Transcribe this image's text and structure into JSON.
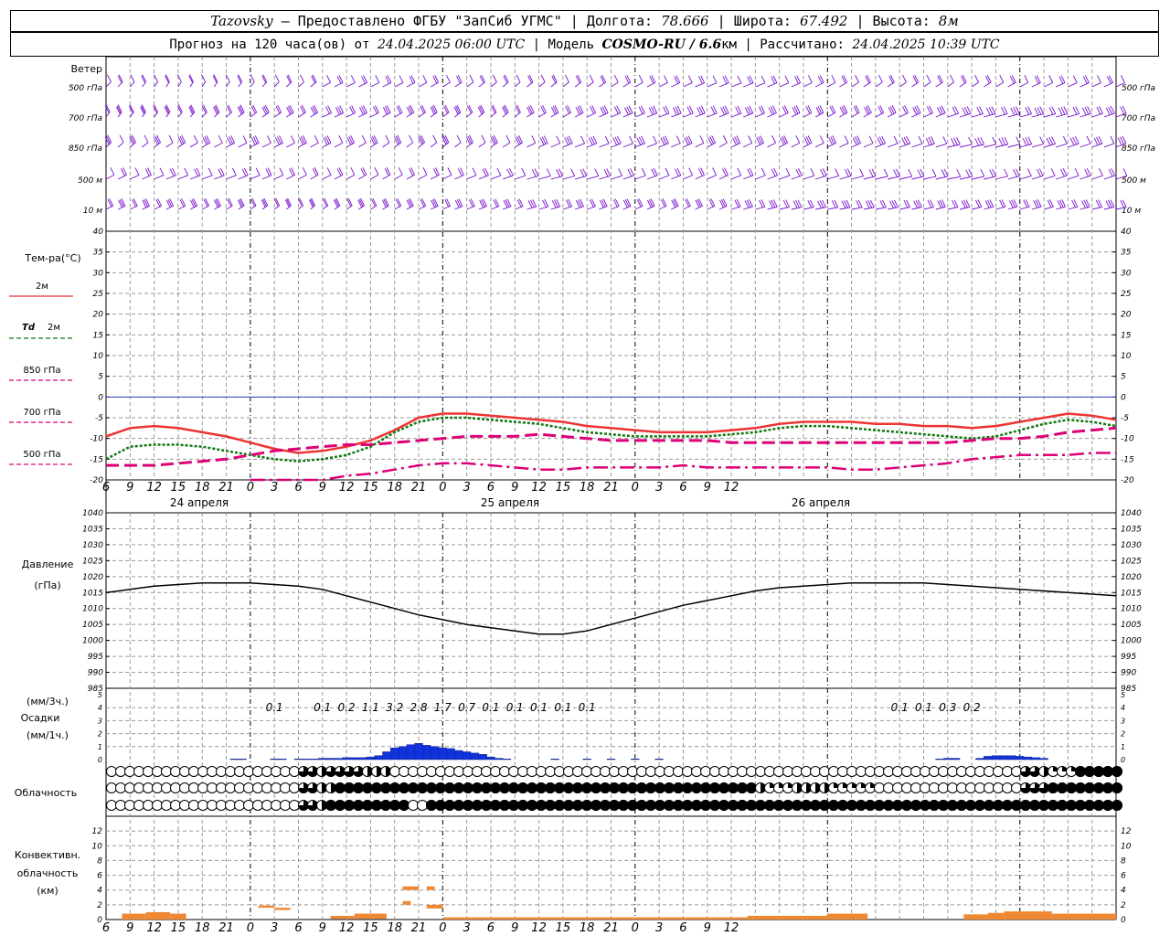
{
  "header": {
    "station": "Tazovsky",
    "provider": "— Предоставлено ФГБУ \"ЗапСиб УГМС\"",
    "lon_label": "Долгота:",
    "lon": "78.666",
    "lat_label": "Широта:",
    "lat": "67.492",
    "alt_label": "Высота:",
    "alt": "8м",
    "forecast_label": "Прогноз на 120 часа(ов) от",
    "forecast_from": "24.04.2025 06:00 UTC",
    "model_label": "Модель",
    "model": "COSMO-RU / 6.6",
    "model_unit": "км",
    "calc_label": "Рассчитано:",
    "calc_time": "24.04.2025 10:39 UTC"
  },
  "labels": {
    "wind": "Ветер",
    "wind_levels": [
      "500 гПа",
      "700 гПа",
      "850 гПа",
      "500 м",
      "10 м"
    ],
    "temp_title": "Тем-ра(°C)",
    "legend_t2m": "2м",
    "legend_td_a": "Td",
    "legend_td_b": "2м",
    "legend_850": "850 гПа",
    "legend_700": "700 гПа",
    "legend_500": "500 гПа",
    "pressure_a": "Давление",
    "pressure_b": "(гПа)",
    "precip_a": "(мм/3ч.)",
    "precip_b": "Осадки",
    "precip_c": "(мм/1ч.)",
    "cloud": "Облачность",
    "conv_a": "Конвективн.",
    "conv_b": "облачность",
    "conv_c": "(км)"
  },
  "colors": {
    "t2m": "#ee3333",
    "td2m": "#117711",
    "t850": "#dd0077",
    "t700": "#dd0077",
    "t500": "#dd0077",
    "wind": "#7711cc",
    "precip": "#1133dd",
    "conv": "#ee8833",
    "zero_line": "#3344cc",
    "grid": "#999999"
  },
  "chart_data": [
    {
      "type": "line",
      "title": "Тем-ра(°C)",
      "x_hours": [
        0,
        3,
        6,
        9,
        12,
        15,
        18,
        21,
        24,
        27,
        30,
        33,
        36,
        39,
        42,
        45,
        48,
        51,
        54,
        57,
        60,
        63,
        66,
        69,
        72,
        75,
        78,
        81,
        84,
        87,
        90,
        93,
        96,
        99,
        102,
        105,
        108,
        111,
        114,
        117,
        120,
        123,
        126
      ],
      "x_tick_labels": [
        "6",
        "9",
        "12",
        "15",
        "18",
        "21",
        "0",
        "3",
        "6",
        "9",
        "12",
        "15",
        "18",
        "21",
        "0",
        "3",
        "6",
        "9",
        "12",
        "15",
        "18",
        "21",
        "0",
        "3",
        "6",
        "9",
        "12"
      ],
      "day_labels": [
        "24 апреля",
        "25 апреля",
        "26 апреля"
      ],
      "ylim": [
        -20,
        40
      ],
      "yticks": [
        40,
        35,
        30,
        25,
        20,
        15,
        10,
        5,
        0,
        -5,
        -10,
        -15,
        -20
      ],
      "series": [
        {
          "name": "2м",
          "values": [
            -9.5,
            -7.5,
            -7,
            -7.5,
            -8.5,
            -9.5,
            -11,
            -12.5,
            -13.5,
            -13,
            -12,
            -10.5,
            -8,
            -5,
            -4,
            -4,
            -4.5,
            -5,
            -5.5,
            -6,
            -7,
            -7.5,
            -8,
            -8.5,
            -8.5,
            -8.5,
            -8,
            -7.5,
            -6.5,
            -6,
            -6,
            -6,
            -6.5,
            -6.5,
            -7,
            -7,
            -7.5,
            -7,
            -6,
            -5,
            -4,
            -4.5,
            -5.5
          ]
        },
        {
          "name": "Td 2м",
          "values": [
            -15,
            -12,
            -11.5,
            -11.5,
            -12,
            -13,
            -14,
            -15,
            -15.5,
            -15,
            -14,
            -12,
            -8.5,
            -6,
            -5,
            -5,
            -5.5,
            -6,
            -6.5,
            -7.5,
            -8.5,
            -9,
            -9.5,
            -9.5,
            -9.5,
            -9.5,
            -9,
            -8.5,
            -7.5,
            -7,
            -7,
            -7.5,
            -8,
            -8.5,
            -9,
            -9.5,
            -10,
            -9.5,
            -8,
            -6.5,
            -5.5,
            -6,
            -7
          ]
        },
        {
          "name": "850 гПа",
          "values": [
            -16.5,
            -16.5,
            -16.5,
            -16,
            -15.5,
            -15,
            -14,
            -13,
            -12.5,
            -12,
            -11.5,
            -11.5,
            -11,
            -10.5,
            -10,
            -9.5,
            -9.5,
            -9.5,
            -9,
            -9.5,
            -10,
            -10.5,
            -10.5,
            -10.5,
            -10.5,
            -10.5,
            -11,
            -11,
            -11,
            -11,
            -11,
            -11,
            -11,
            -11,
            -11,
            -11,
            -10.5,
            -10,
            -10,
            -9.5,
            -8.5,
            -8,
            -7.5
          ]
        },
        {
          "name": "700 гПа",
          "values": [
            null,
            null,
            null,
            null,
            null,
            null,
            -20,
            -20,
            -20,
            -20,
            -19,
            -18.5,
            -17.5,
            -16.5,
            -16,
            -16,
            -16.5,
            -17,
            -17.5,
            -17.5,
            -17,
            -17,
            -17,
            -17,
            -16.5,
            -17,
            -17,
            -17,
            -17,
            -17,
            -17,
            -17.5,
            -17.5,
            -17,
            -16.5,
            -16,
            -15,
            -14.5,
            -14,
            -14,
            -14,
            -13.5,
            -13.5
          ]
        },
        {
          "name": "500 гПа",
          "values": []
        }
      ]
    },
    {
      "type": "line",
      "title": "Давление",
      "ylabel": "(гПа)",
      "ylim": [
        985,
        1040
      ],
      "yticks": [
        1040,
        1035,
        1030,
        1025,
        1020,
        1015,
        1010,
        1005,
        1000,
        995,
        990,
        985
      ],
      "series": [
        {
          "name": "Давление",
          "values": [
            1015,
            1016,
            1017,
            1017.5,
            1018,
            1018,
            1018,
            1017.5,
            1017,
            1016,
            1014,
            1012,
            1010,
            1008,
            1006.5,
            1005,
            1004,
            1003,
            1002,
            1002,
            1003,
            1005,
            1007,
            1009,
            1011,
            1012.5,
            1014,
            1015.5,
            1016.5,
            1017,
            1017.5,
            1018,
            1018,
            1018,
            1018,
            1017.5,
            1017,
            1016.5,
            1016,
            1015.5,
            1015,
            1014.5,
            1014
          ]
        }
      ]
    },
    {
      "type": "bar",
      "title": "Осадки",
      "units_3h": "(мм/3ч.)",
      "units_1h": "(мм/1ч.)",
      "ylim": [
        0,
        5
      ],
      "labels_3h": [
        {
          "hour": 21,
          "text": "0.1"
        },
        {
          "hour": 27,
          "text": "0.1"
        },
        {
          "hour": 30,
          "text": "0.2"
        },
        {
          "hour": 33,
          "text": "1.1"
        },
        {
          "hour": 36,
          "text": "3.2"
        },
        {
          "hour": 39,
          "text": "2.8"
        },
        {
          "hour": 42,
          "text": "1.7"
        },
        {
          "hour": 45,
          "text": "0.7"
        },
        {
          "hour": 48,
          "text": "0.1"
        },
        {
          "hour": 51,
          "text": "0.1"
        },
        {
          "hour": 54,
          "text": "0.1"
        },
        {
          "hour": 57,
          "text": "0.1"
        },
        {
          "hour": 60,
          "text": "0.1"
        },
        {
          "hour": 99,
          "text": "0.1"
        },
        {
          "hour": 102,
          "text": "0.1"
        },
        {
          "hour": 105,
          "text": "0.3"
        },
        {
          "hour": 108,
          "text": "0.2"
        }
      ],
      "hourly_mm": [
        {
          "hour": 16,
          "v": 0.05
        },
        {
          "hour": 17,
          "v": 0.05
        },
        {
          "hour": 21,
          "v": 0.05
        },
        {
          "hour": 22,
          "v": 0.05
        },
        {
          "hour": 24,
          "v": 0.05
        },
        {
          "hour": 25,
          "v": 0.05
        },
        {
          "hour": 26,
          "v": 0.05
        },
        {
          "hour": 27,
          "v": 0.1
        },
        {
          "hour": 28,
          "v": 0.1
        },
        {
          "hour": 29,
          "v": 0.1
        },
        {
          "hour": 30,
          "v": 0.15
        },
        {
          "hour": 31,
          "v": 0.15
        },
        {
          "hour": 32,
          "v": 0.15
        },
        {
          "hour": 33,
          "v": 0.2
        },
        {
          "hour": 34,
          "v": 0.3
        },
        {
          "hour": 35,
          "v": 0.6
        },
        {
          "hour": 36,
          "v": 0.9
        },
        {
          "hour": 37,
          "v": 1.0
        },
        {
          "hour": 38,
          "v": 1.15
        },
        {
          "hour": 39,
          "v": 1.25
        },
        {
          "hour": 40,
          "v": 1.1
        },
        {
          "hour": 41,
          "v": 1.0
        },
        {
          "hour": 42,
          "v": 0.9
        },
        {
          "hour": 43,
          "v": 0.85
        },
        {
          "hour": 44,
          "v": 0.7
        },
        {
          "hour": 45,
          "v": 0.6
        },
        {
          "hour": 46,
          "v": 0.5
        },
        {
          "hour": 47,
          "v": 0.4
        },
        {
          "hour": 48,
          "v": 0.2
        },
        {
          "hour": 49,
          "v": 0.1
        },
        {
          "hour": 50,
          "v": 0.05
        },
        {
          "hour": 56,
          "v": 0.05
        },
        {
          "hour": 60,
          "v": 0.05
        },
        {
          "hour": 63,
          "v": 0.05
        },
        {
          "hour": 66,
          "v": 0.05
        },
        {
          "hour": 69,
          "v": 0.05
        },
        {
          "hour": 104,
          "v": 0.05
        },
        {
          "hour": 105,
          "v": 0.1
        },
        {
          "hour": 106,
          "v": 0.1
        },
        {
          "hour": 109,
          "v": 0.1
        },
        {
          "hour": 110,
          "v": 0.25
        },
        {
          "hour": 111,
          "v": 0.3
        },
        {
          "hour": 112,
          "v": 0.3
        },
        {
          "hour": 113,
          "v": 0.3
        },
        {
          "hour": 114,
          "v": 0.25
        },
        {
          "hour": 115,
          "v": 0.2
        },
        {
          "hour": 116,
          "v": 0.15
        },
        {
          "hour": 117,
          "v": 0.1
        }
      ]
    },
    {
      "type": "heatmap",
      "title": "Облачность",
      "note": "cloud cover fraction per hour in three layers (0 = clear, 1 = overcast)",
      "layers": [
        {
          "name": "upper",
          "segments": [
            [
              0,
              20,
              0
            ],
            [
              21,
              22,
              0.75
            ],
            [
              23,
              23,
              0.5
            ],
            [
              24,
              27,
              0.75
            ],
            [
              28,
              30,
              0.5
            ],
            [
              31,
              99,
              0
            ],
            [
              100,
              101,
              0.75
            ],
            [
              102,
              102,
              0.5
            ],
            [
              103,
              105,
              0.25
            ],
            [
              106,
              110,
              1
            ]
          ]
        },
        {
          "name": "middle",
          "segments": [
            [
              0,
              20,
              0
            ],
            [
              21,
              22,
              0.75
            ],
            [
              23,
              24,
              0.5
            ],
            [
              25,
              70,
              1
            ],
            [
              71,
              71,
              0.5
            ],
            [
              72,
              74,
              0.25
            ],
            [
              75,
              78,
              0.5
            ],
            [
              79,
              83,
              0.25
            ],
            [
              84,
              99,
              0
            ],
            [
              100,
              102,
              0.75
            ],
            [
              103,
              110,
              1
            ]
          ]
        },
        {
          "name": "lower",
          "segments": [
            [
              0,
              20,
              0
            ],
            [
              21,
              22,
              0.75
            ],
            [
              23,
              23,
              0.5
            ],
            [
              24,
              32,
              1
            ],
            [
              33,
              34,
              0
            ],
            [
              35,
              110,
              1
            ]
          ]
        }
      ]
    },
    {
      "type": "bar",
      "title": "Конвективн. облачность",
      "ylabel": "(км)",
      "ylim": [
        0,
        14
      ],
      "yticks": [
        0,
        2,
        4,
        6,
        8,
        10,
        12
      ],
      "segments_km": [
        {
          "from": 2,
          "to": 5,
          "base": 0,
          "top": 0.8
        },
        {
          "from": 5,
          "to": 8,
          "base": 0,
          "top": 1.0
        },
        {
          "from": 8,
          "to": 10,
          "base": 0,
          "top": 0.8
        },
        {
          "from": 19,
          "to": 21,
          "base": 1.6,
          "top": 1.9
        },
        {
          "from": 21,
          "to": 23,
          "base": 1.3,
          "top": 1.6
        },
        {
          "from": 28,
          "to": 31,
          "base": 0.1,
          "top": 0.5
        },
        {
          "from": 31,
          "to": 35,
          "base": 0.1,
          "top": 0.8
        },
        {
          "from": 37,
          "to": 39,
          "base": 4.0,
          "top": 4.5
        },
        {
          "from": 37,
          "to": 38,
          "base": 2.0,
          "top": 2.5
        },
        {
          "from": 40,
          "to": 41,
          "base": 4.0,
          "top": 4.5
        },
        {
          "from": 40,
          "to": 42,
          "base": 1.5,
          "top": 2.0
        },
        {
          "from": 42,
          "to": 80,
          "base": 0,
          "top": 0.3
        },
        {
          "from": 80,
          "to": 90,
          "base": 0,
          "top": 0.5
        },
        {
          "from": 90,
          "to": 95,
          "base": 0,
          "top": 0.8
        },
        {
          "from": 107,
          "to": 110,
          "base": 0,
          "top": 0.7
        },
        {
          "from": 110,
          "to": 112,
          "base": 0,
          "top": 0.9
        },
        {
          "from": 112,
          "to": 118,
          "base": 0,
          "top": 1.1
        },
        {
          "from": 118,
          "to": 126,
          "base": 0,
          "top": 0.8
        }
      ]
    }
  ]
}
